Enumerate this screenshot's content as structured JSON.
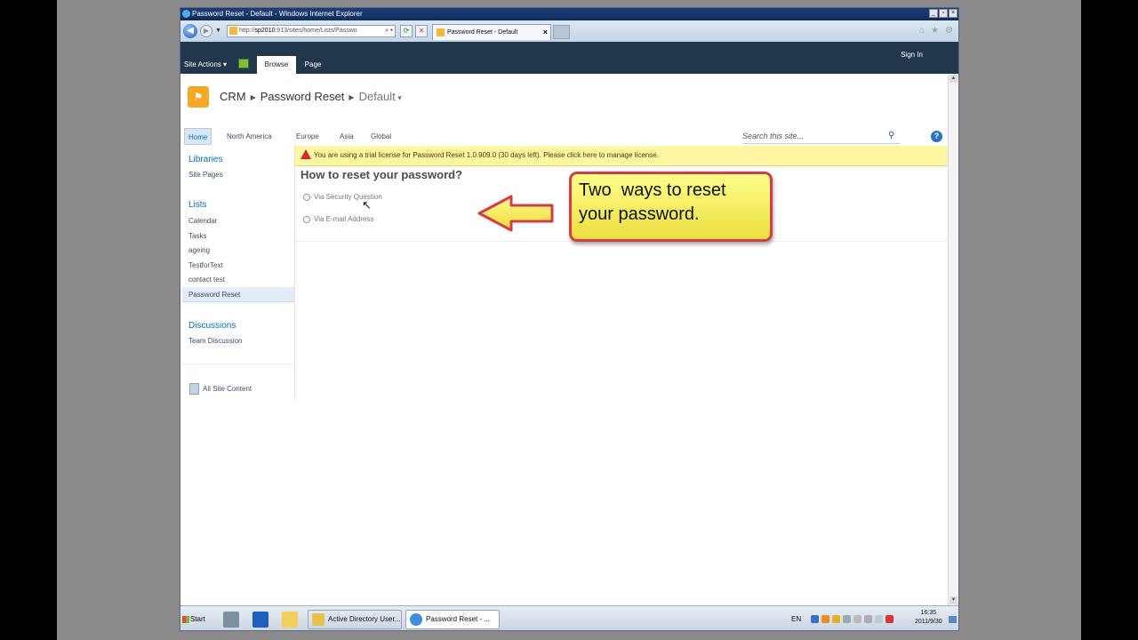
{
  "window": {
    "title": "Password Reset - Default - Windows Internet Explorer",
    "buttons": {
      "minimize": "_",
      "maximize": "▫",
      "close": "×"
    }
  },
  "browser": {
    "address_prefix": "http://",
    "address_host": "sp2010",
    "address_path": ":913/sites/home/Lists/Passwo",
    "tab_title": "Password Reset - Default",
    "tab_close": "×"
  },
  "ribbon": {
    "site_actions": "Site Actions",
    "tab_browse": "Browse",
    "tab_page": "Page",
    "sign_in": "Sign In"
  },
  "breadcrumb": {
    "items": [
      "CRM",
      "Password Reset",
      "Default"
    ]
  },
  "topnav": {
    "items": [
      "Home",
      "North America",
      "Europe",
      "Asia",
      "Global"
    ]
  },
  "search": {
    "placeholder": "Search this site..."
  },
  "quicklaunch": {
    "libraries_header": "Libraries",
    "libraries": [
      "Site Pages"
    ],
    "lists_header": "Lists",
    "lists": [
      "Calendar",
      "Tasks",
      "ageing",
      "TestforText",
      "contact test",
      "Password Reset"
    ],
    "discussions_header": "Discussions",
    "discussions": [
      "Team Discussion"
    ],
    "all_site_content": "All Site Content"
  },
  "trial_notice": "You are using a trial license for Password Reset 1.0.909.0 (30 days left). Please click here to manage license.",
  "main": {
    "heading": "How to reset your password?",
    "option_security": "Via Security Question",
    "option_email": "Via E-mail Address"
  },
  "callout": {
    "line1": "Two  ways to reset",
    "line2": "your password."
  },
  "taskbar": {
    "start": "Start",
    "task_ad": "Active Directory User...",
    "task_ie": "Password Reset - ...",
    "lang": "EN",
    "time": "16:35",
    "date": "2011/9/30"
  },
  "colors": {
    "ribbon": "#21374c",
    "callout_border": "#d33d47",
    "callout_fill": "#fff48a",
    "trial_bg": "#fff6a3",
    "link": "#0072bc"
  }
}
